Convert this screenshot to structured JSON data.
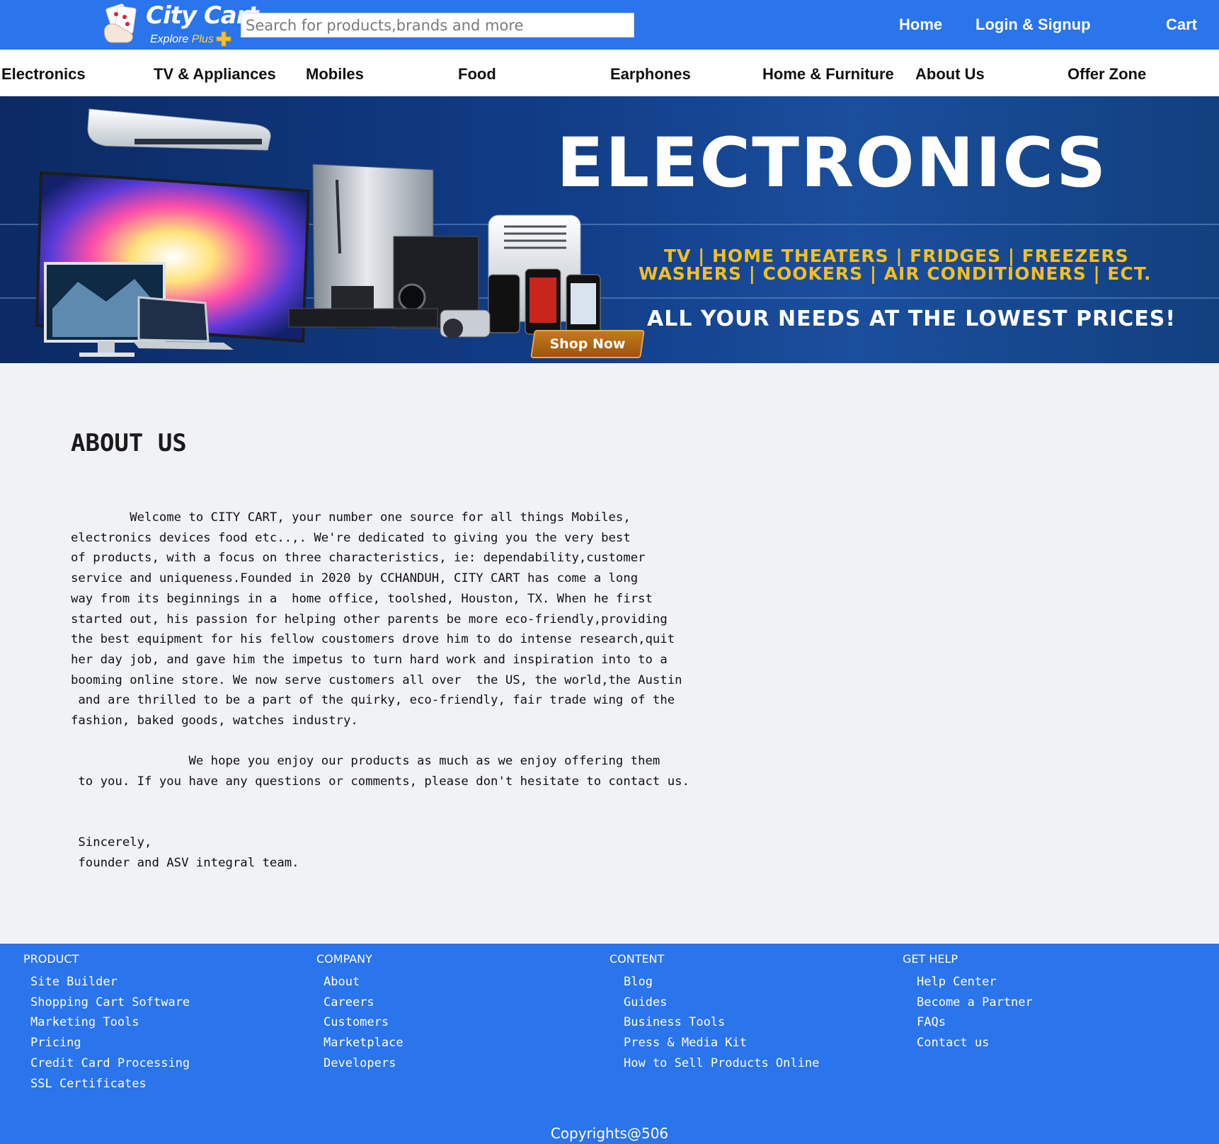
{
  "header": {
    "logo_title": "City Cart",
    "logo_sub_left": "Explore",
    "logo_sub_right": "Plus",
    "search_placeholder": "Search for products,brands and more",
    "links": {
      "home": "Home",
      "login": "Login & Signup",
      "cart": "Cart"
    }
  },
  "categories": [
    "Electronics",
    "TV & Appliances",
    "Mobiles",
    "Food",
    "Earphones",
    "Home & Furniture",
    "About Us",
    "Offer Zone"
  ],
  "banner": {
    "title": "ELECTRONICS",
    "line1": "TV | HOME THEATERS | FRIDGES | FREEZERS",
    "line2": "WASHERS | COOKERS | AIR CONDITIONERS | ECT.",
    "tagline": "ALL YOUR NEEDS AT THE LOWEST PRICES!",
    "shop_now": "Shop Now"
  },
  "about": {
    "title": "ABOUT US",
    "body": "        Welcome to CITY CART, your number one source for all things Mobiles,\nelectronics devices food etc..,. We're dedicated to giving you the very best\nof products, with a focus on three characteristics, ie: dependability,customer\nservice and uniqueness.Founded in 2020 by CCHANDUH, CITY CART has come a long\nway from its beginnings in a  home office, toolshed, Houston, TX. When he first\nstarted out, his passion for helping other parents be more eco-friendly,providing\nthe best equipment for his fellow coustomers drove him to do intense research,quit\nher day job, and gave him the impetus to turn hard work and inspiration into to a\nbooming online store. We now serve customers all over  the US, the world,the Austin\n and are thrilled to be a part of the quirky, eco-friendly, fair trade wing of the\nfashion, baked goods, watches industry.\n\n                We hope you enjoy our products as much as we enjoy offering them\n to you. If you have any questions or comments, please don't hesitate to contact us.\n\n\n Sincerely,\n founder and ASV integral team."
  },
  "footer": {
    "columns": [
      {
        "heading": "PRODUCT",
        "links": [
          "Site Builder",
          "Shopping Cart Software",
          "Marketing Tools",
          "Pricing",
          "Credit Card Processing",
          "SSL Certificates"
        ]
      },
      {
        "heading": "COMPANY",
        "links": [
          "About",
          "Careers",
          "Customers",
          "Marketplace",
          "Developers"
        ]
      },
      {
        "heading": "CONTENT",
        "links": [
          "Blog",
          "Guides",
          "Business Tools",
          "Press & Media Kit",
          "How to Sell Products Online"
        ]
      },
      {
        "heading": "GET HELP",
        "links": [
          "Help Center",
          "Become a Partner",
          "FAQs",
          "Contact us"
        ]
      }
    ],
    "copyright": "Copyrights@506"
  },
  "colors": {
    "header_blue": "#2a74ec",
    "banner_navy": "#113c86",
    "banner_gold": "#f2bf23",
    "page_background": "#f1f2f6"
  },
  "icons": [
    "logo-cards-icon",
    "plus-badge-icon"
  ]
}
